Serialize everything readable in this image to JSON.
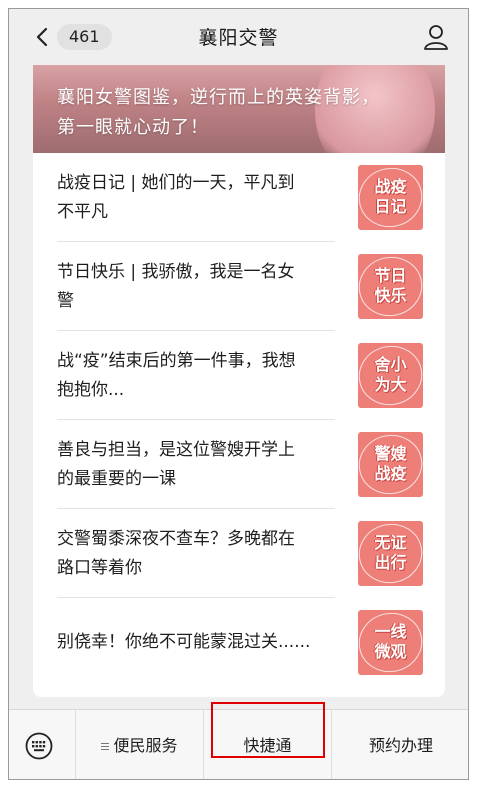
{
  "nav": {
    "back_count": "461",
    "title": "襄阳交警"
  },
  "banner": {
    "line1": "襄阳女警图鉴，逆行而上的英姿背影，",
    "line2": "第一眼就心动了！"
  },
  "articles": [
    {
      "line1": "战疫日记 | 她们的一天，平凡到",
      "line2": "不平凡",
      "thumb_top": "战疫",
      "thumb_bottom": "日记"
    },
    {
      "line1": "节日快乐 | 我骄傲，我是一名女",
      "line2": "警",
      "thumb_top": "节日",
      "thumb_bottom": "快乐"
    },
    {
      "line1": "战“疫”结束后的第一件事，我想",
      "line2": "抱抱你...",
      "thumb_top": "舍小",
      "thumb_bottom": "为大"
    },
    {
      "line1": "善良与担当，是这位警嫂开学上",
      "line2": "的最重要的一课",
      "thumb_top": "警嫂",
      "thumb_bottom": "战疫"
    },
    {
      "line1": "交警蜀黍深夜不查车？多晚都在",
      "line2": "路口等着你",
      "thumb_top": "无证",
      "thumb_bottom": "出行"
    },
    {
      "line1": "别侥幸！你绝不可能蒙混过关......",
      "line2": "",
      "thumb_top": "一线",
      "thumb_bottom": "微观"
    }
  ],
  "menu": {
    "item1": "便民服务",
    "item2": "快捷通",
    "item3": "预约办理"
  },
  "colors": {
    "thumb_bg": "#ee7e78",
    "highlight": "#e00000"
  }
}
